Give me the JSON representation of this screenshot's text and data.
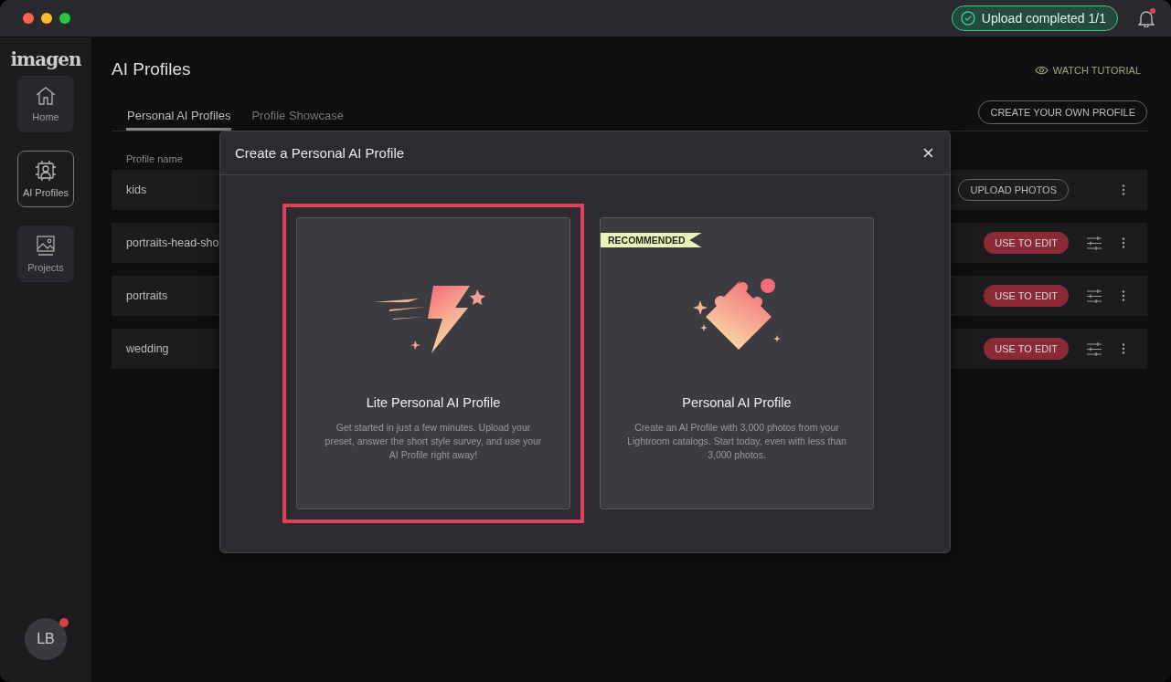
{
  "upload_status": {
    "text": "Upload completed 1/1"
  },
  "notifications": {
    "unread": true
  },
  "sidebar": {
    "logo": "imagen",
    "items": [
      {
        "label": "Home",
        "selected": false,
        "kind": "home"
      },
      {
        "label": "AI Profiles",
        "selected": true,
        "kind": "profiles"
      },
      {
        "label": "Projects",
        "selected": false,
        "kind": "projects"
      }
    ],
    "avatar": {
      "initials": "LB",
      "unread": true
    }
  },
  "page": {
    "title": "AI Profiles",
    "watch_tutorial": "WATCH TUTORIAL",
    "create_button": "CREATE YOUR OWN PROFILE",
    "tabs": [
      {
        "label": "Personal AI Profiles",
        "selected": true
      },
      {
        "label": "Profile Showcase",
        "selected": false
      }
    ],
    "table": {
      "columns": [
        "Profile name"
      ],
      "rows": [
        {
          "name": "kids",
          "action": "UPLOAD PHOTOS",
          "kind": "upload"
        },
        {
          "name": "portraits-head-sho",
          "action": "USE TO EDIT",
          "kind": "edit"
        },
        {
          "name": "portraits",
          "action": "USE TO EDIT",
          "kind": "edit"
        },
        {
          "name": "wedding",
          "action": "USE TO EDIT",
          "kind": "edit"
        }
      ]
    }
  },
  "dialog": {
    "title": "Create a Personal AI Profile",
    "options": [
      {
        "kind": "lite",
        "title": "Lite Personal AI Profile",
        "description": "Get started in just a few minutes. Upload your preset, answer the short style survey, and use your AI Profile right away!",
        "selected": true
      },
      {
        "kind": "full",
        "badge": "RECOMMENDED",
        "title": "Personal AI Profile",
        "description": "Create an AI Profile with 3,000 photos from your Lightroom catalogs. Start today, even with less than 3,000 photos.",
        "selected": false
      }
    ]
  }
}
